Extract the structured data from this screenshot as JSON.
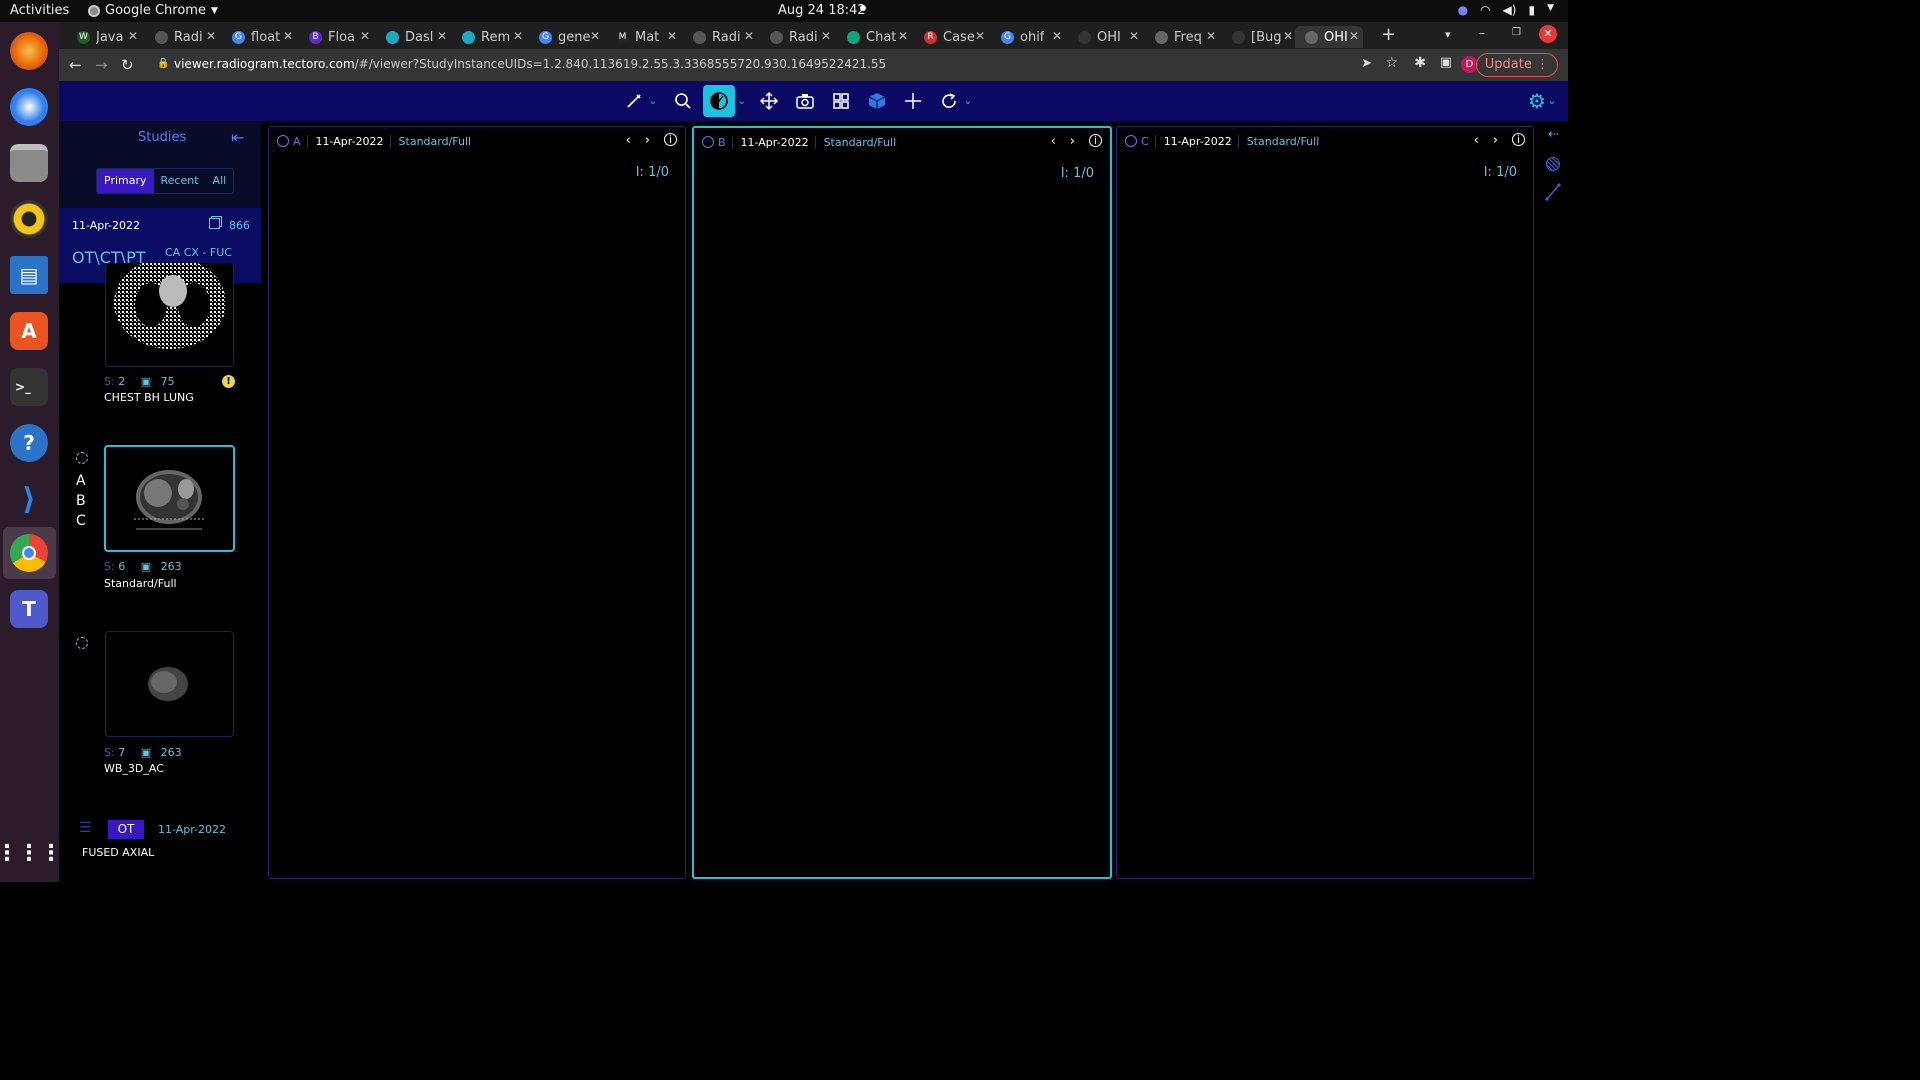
{
  "topbar": {
    "activities": "Activities",
    "app": "Google Chrome",
    "clock": "Aug 24  18:42"
  },
  "tabs": [
    {
      "label": "Java",
      "color": "#1b5e20",
      "glyph": "W"
    },
    {
      "label": "Radi",
      "color": "#555555",
      "glyph": ""
    },
    {
      "label": "float",
      "color": "#4285f4",
      "glyph": "G"
    },
    {
      "label": "Floa",
      "color": "#5b2cc9",
      "glyph": "B"
    },
    {
      "label": "Dasl",
      "color": "#1ea7c4",
      "glyph": ""
    },
    {
      "label": "Rem",
      "color": "#1ea7c4",
      "glyph": ""
    },
    {
      "label": "gene",
      "color": "#4285f4",
      "glyph": "G"
    },
    {
      "label": "Mat",
      "color": "#222222",
      "glyph": "M"
    },
    {
      "label": "Radi",
      "color": "#555555",
      "glyph": ""
    },
    {
      "label": "Radi",
      "color": "#555555",
      "glyph": ""
    },
    {
      "label": "Chat",
      "color": "#10a37f",
      "glyph": ""
    },
    {
      "label": "Case",
      "color": "#d32f2f",
      "glyph": "R"
    },
    {
      "label": "ohif",
      "color": "#4285f4",
      "glyph": "G"
    },
    {
      "label": "OHI",
      "color": "#333333",
      "glyph": ""
    },
    {
      "label": "Freq",
      "color": "#666666",
      "glyph": ""
    },
    {
      "label": "[Bug",
      "color": "#333333",
      "glyph": ""
    },
    {
      "label": "OHI",
      "color": "#666666",
      "glyph": ""
    }
  ],
  "address": {
    "host": "viewer.radiogram.tectoro.com",
    "path": "/#/viewer?StudyInstanceUIDs=1.2.840.113619.2.55.3.3368555720.930.1649522421.55",
    "update_label": "Update",
    "profile": "D"
  },
  "sidebar": {
    "title": "Studies",
    "tabs": [
      "Primary",
      "Recent",
      "All"
    ],
    "study": {
      "date": "11-Apr-2022",
      "count": "866",
      "modality": "OT\\CT\\PT",
      "description": "CA CX - FUC"
    },
    "series": [
      {
        "s_label": "S:",
        "number": "2",
        "instances": "75",
        "name": "CHEST BH LUNG"
      },
      {
        "s_label": "S:",
        "number": "6",
        "instances": "263",
        "name": "Standard/Full"
      },
      {
        "s_label": "S:",
        "number": "7",
        "instances": "263",
        "name": "WB_3D_AC"
      }
    ],
    "viewport_letters": [
      "A",
      "B",
      "C"
    ],
    "footer": {
      "modality": "OT",
      "date": "11-Apr-2022",
      "name": "FUSED AXIAL"
    }
  },
  "viewports": [
    {
      "letter": "A",
      "date": "11-Apr-2022",
      "series": "Standard/Full",
      "index": "I: 1/0"
    },
    {
      "letter": "B",
      "date": "11-Apr-2022",
      "series": "Standard/Full",
      "index": "I: 1/0"
    },
    {
      "letter": "C",
      "date": "11-Apr-2022",
      "series": "Standard/Full",
      "index": "I: 1/0"
    }
  ]
}
